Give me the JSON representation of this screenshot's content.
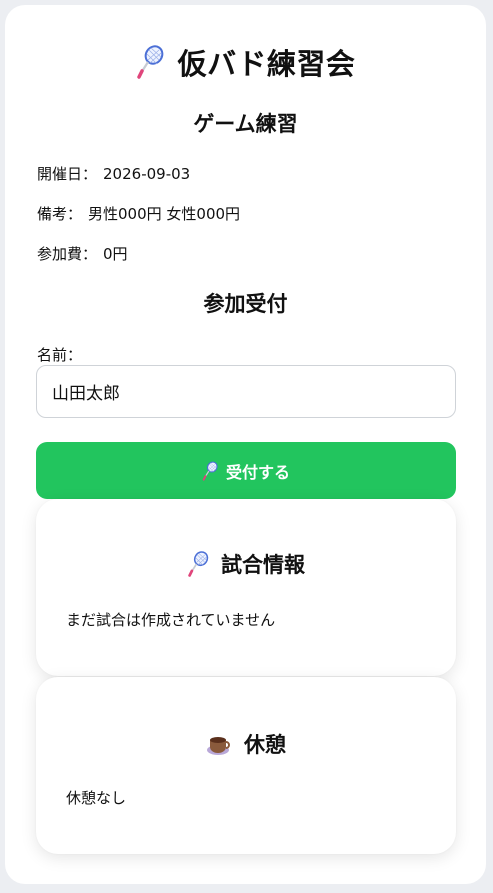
{
  "app": {
    "title": "仮バド練習会",
    "title_icon": "badminton-racket-icon"
  },
  "event": {
    "name": "ゲーム練習",
    "date_label": "開催日：",
    "date_value": "2026-09-03",
    "note_label": "備考：",
    "note_value": "男性000円 女性000円",
    "fee_label": "参加費：",
    "fee_value": "0円"
  },
  "registration": {
    "heading": "参加受付",
    "name_label": "名前：",
    "name_value": "山田太郎",
    "submit_label": "受付する"
  },
  "match_card": {
    "title": "試合情報",
    "message": "まだ試合は作成されていません",
    "icon": "badminton-racket-icon"
  },
  "break_card": {
    "title": "休憩",
    "message": "休憩なし",
    "icon": "coffee-cup-icon"
  },
  "colors": {
    "accent": "#22c55e",
    "background": "#eceef2",
    "surface": "#ffffff"
  }
}
